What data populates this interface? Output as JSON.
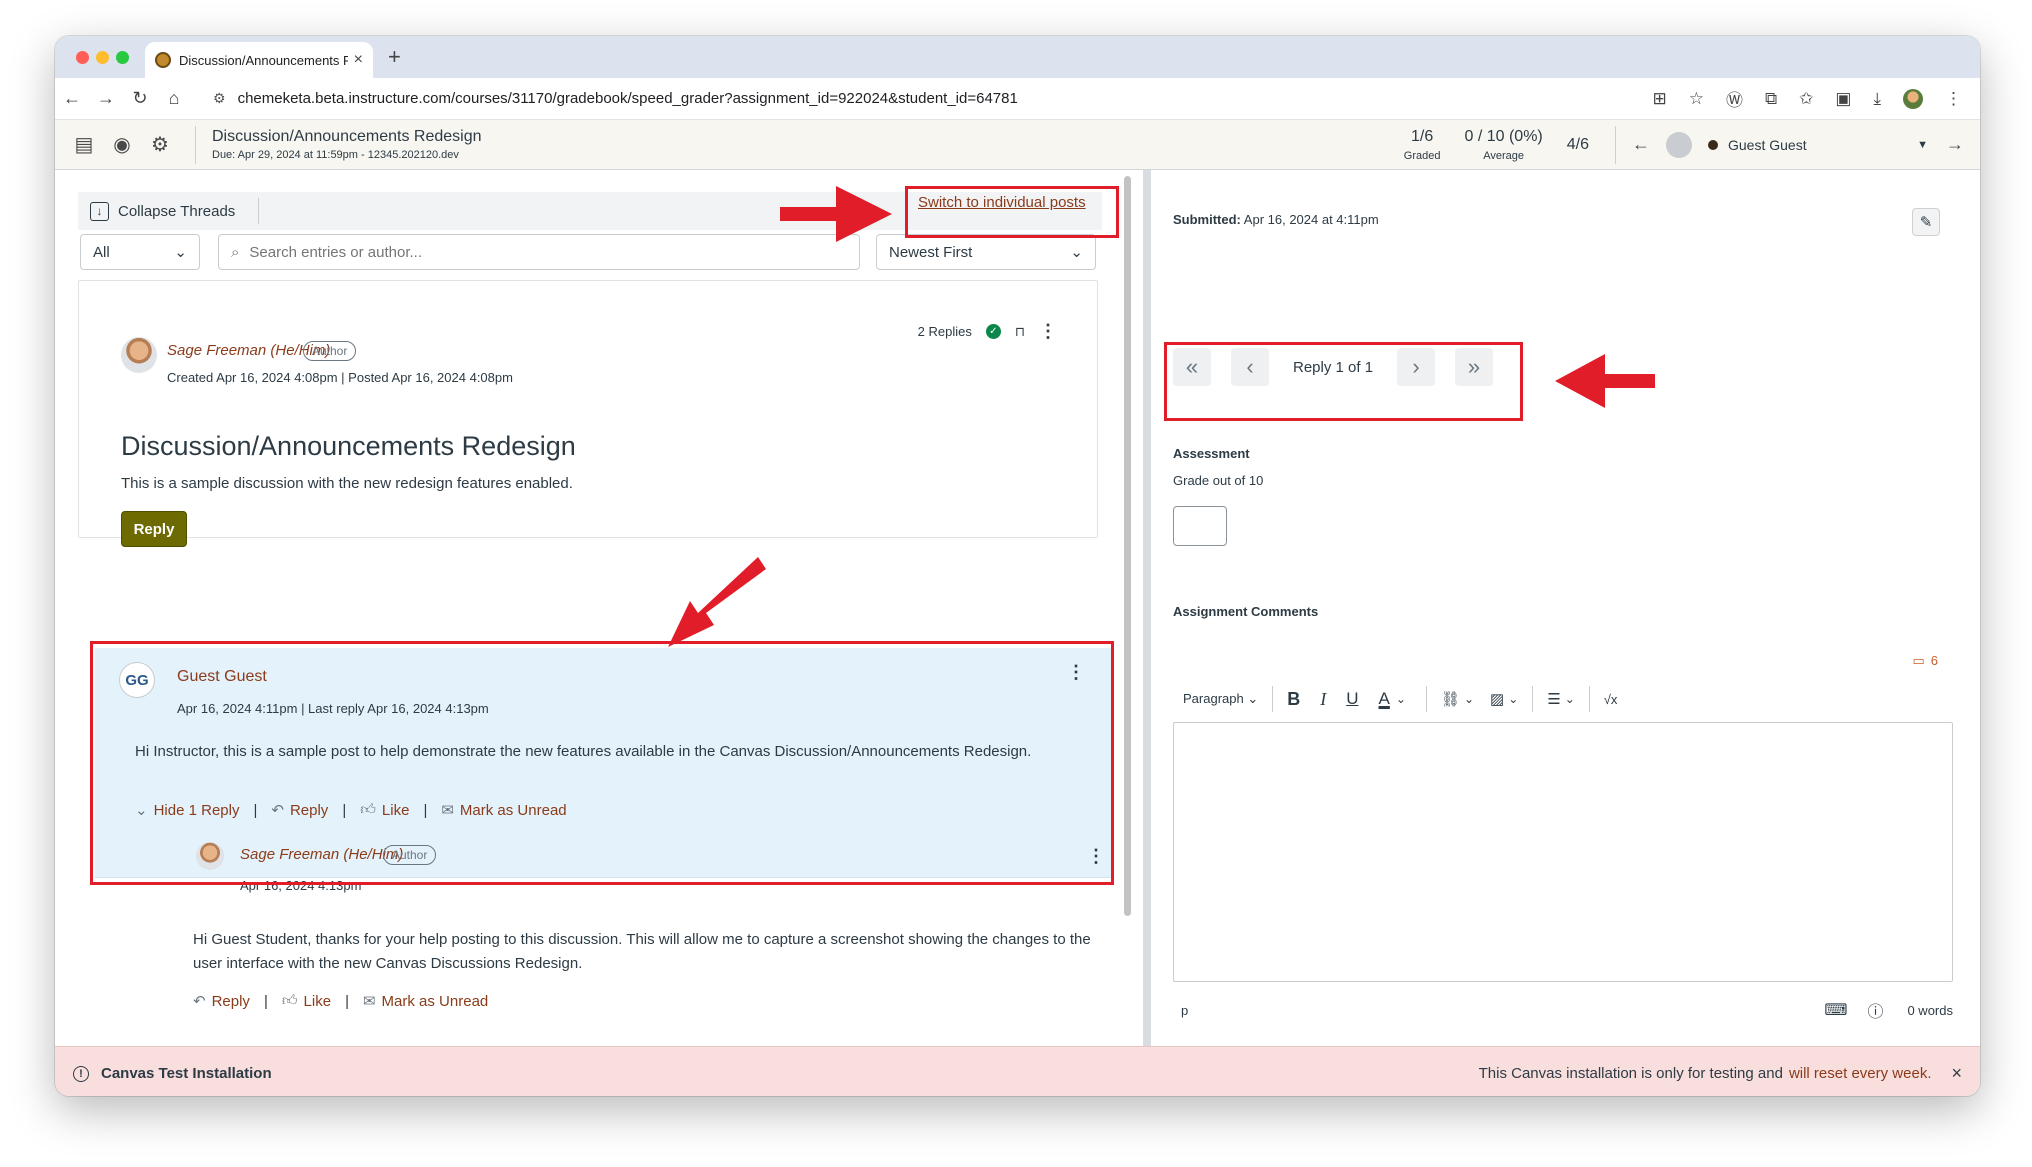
{
  "browser": {
    "tab_title": "Discussion/Announcements R",
    "url": "chemeketa.beta.instructure.com/courses/31170/gradebook/speed_grader?assignment_id=922024&student_id=64781"
  },
  "header": {
    "assignment_title": "Discussion/Announcements Redesign",
    "assignment_due": "Due: Apr 29, 2024 at 11:59pm - 12345.202120.dev",
    "graded_value": "1/6",
    "graded_label": "Graded",
    "average_value": "0 / 10 (0%)",
    "average_label": "Average",
    "student_index": "4/6",
    "student_name": "Guest Guest"
  },
  "thread": {
    "collapse_label": "Collapse Threads",
    "switch_link": "Switch to individual posts",
    "filter_value": "All",
    "search_placeholder": "Search entries or author...",
    "sort_value": "Newest First"
  },
  "topic": {
    "replies_count": "2 Replies",
    "author_name": "Sage Freeman (He/Him)",
    "author_badge": "Author",
    "meta": "Created Apr 16, 2024 4:08pm | Posted Apr 16, 2024 4:08pm",
    "title": "Discussion/Announcements Redesign",
    "body": "This is a sample discussion with the new redesign features enabled.",
    "reply_label": "Reply"
  },
  "entry": {
    "initials": "GG",
    "author_name": "Guest Guest",
    "meta": "Apr 16, 2024 4:11pm | Last reply Apr 16, 2024 4:13pm",
    "body": "Hi Instructor, this is a sample post to help demonstrate the new features available in the Canvas Discussion/Announcements Redesign.",
    "hide_label": "Hide 1 Reply",
    "reply_label": "Reply",
    "like_label": "Like",
    "unread_label": "Mark as Unread"
  },
  "reply": {
    "author_name": "Sage Freeman (He/Him)",
    "author_badge": "Author",
    "meta": "Apr 16, 2024 4:13pm",
    "body": "Hi Guest Student, thanks for your help posting to this discussion. This will allow me to capture a screenshot showing the changes to the user interface with the new Canvas Discussions Redesign.",
    "reply_label": "Reply",
    "like_label": "Like",
    "unread_label": "Mark as Unread"
  },
  "grading": {
    "submitted_label": "Submitted:",
    "submitted_value": "Apr 16, 2024 at 4:11pm",
    "pager_label": "Reply 1 of 1",
    "assessment_heading": "Assessment",
    "grade_label": "Grade out of 10",
    "comments_heading": "Assignment Comments",
    "comments_count": "6",
    "paragraph_label": "Paragraph",
    "path_label": "p",
    "word_count": "0 words"
  },
  "banner": {
    "title": "Canvas Test Installation",
    "message": "This Canvas installation is only for testing and",
    "link": "will reset every week."
  },
  "colors": {
    "annotation_red": "#e11d2a",
    "link_brown": "#8a3b1a",
    "reply_button_olive": "#6c6a00",
    "entry_highlight": "#e4f2fb",
    "banner_pink": "#f9dede"
  }
}
